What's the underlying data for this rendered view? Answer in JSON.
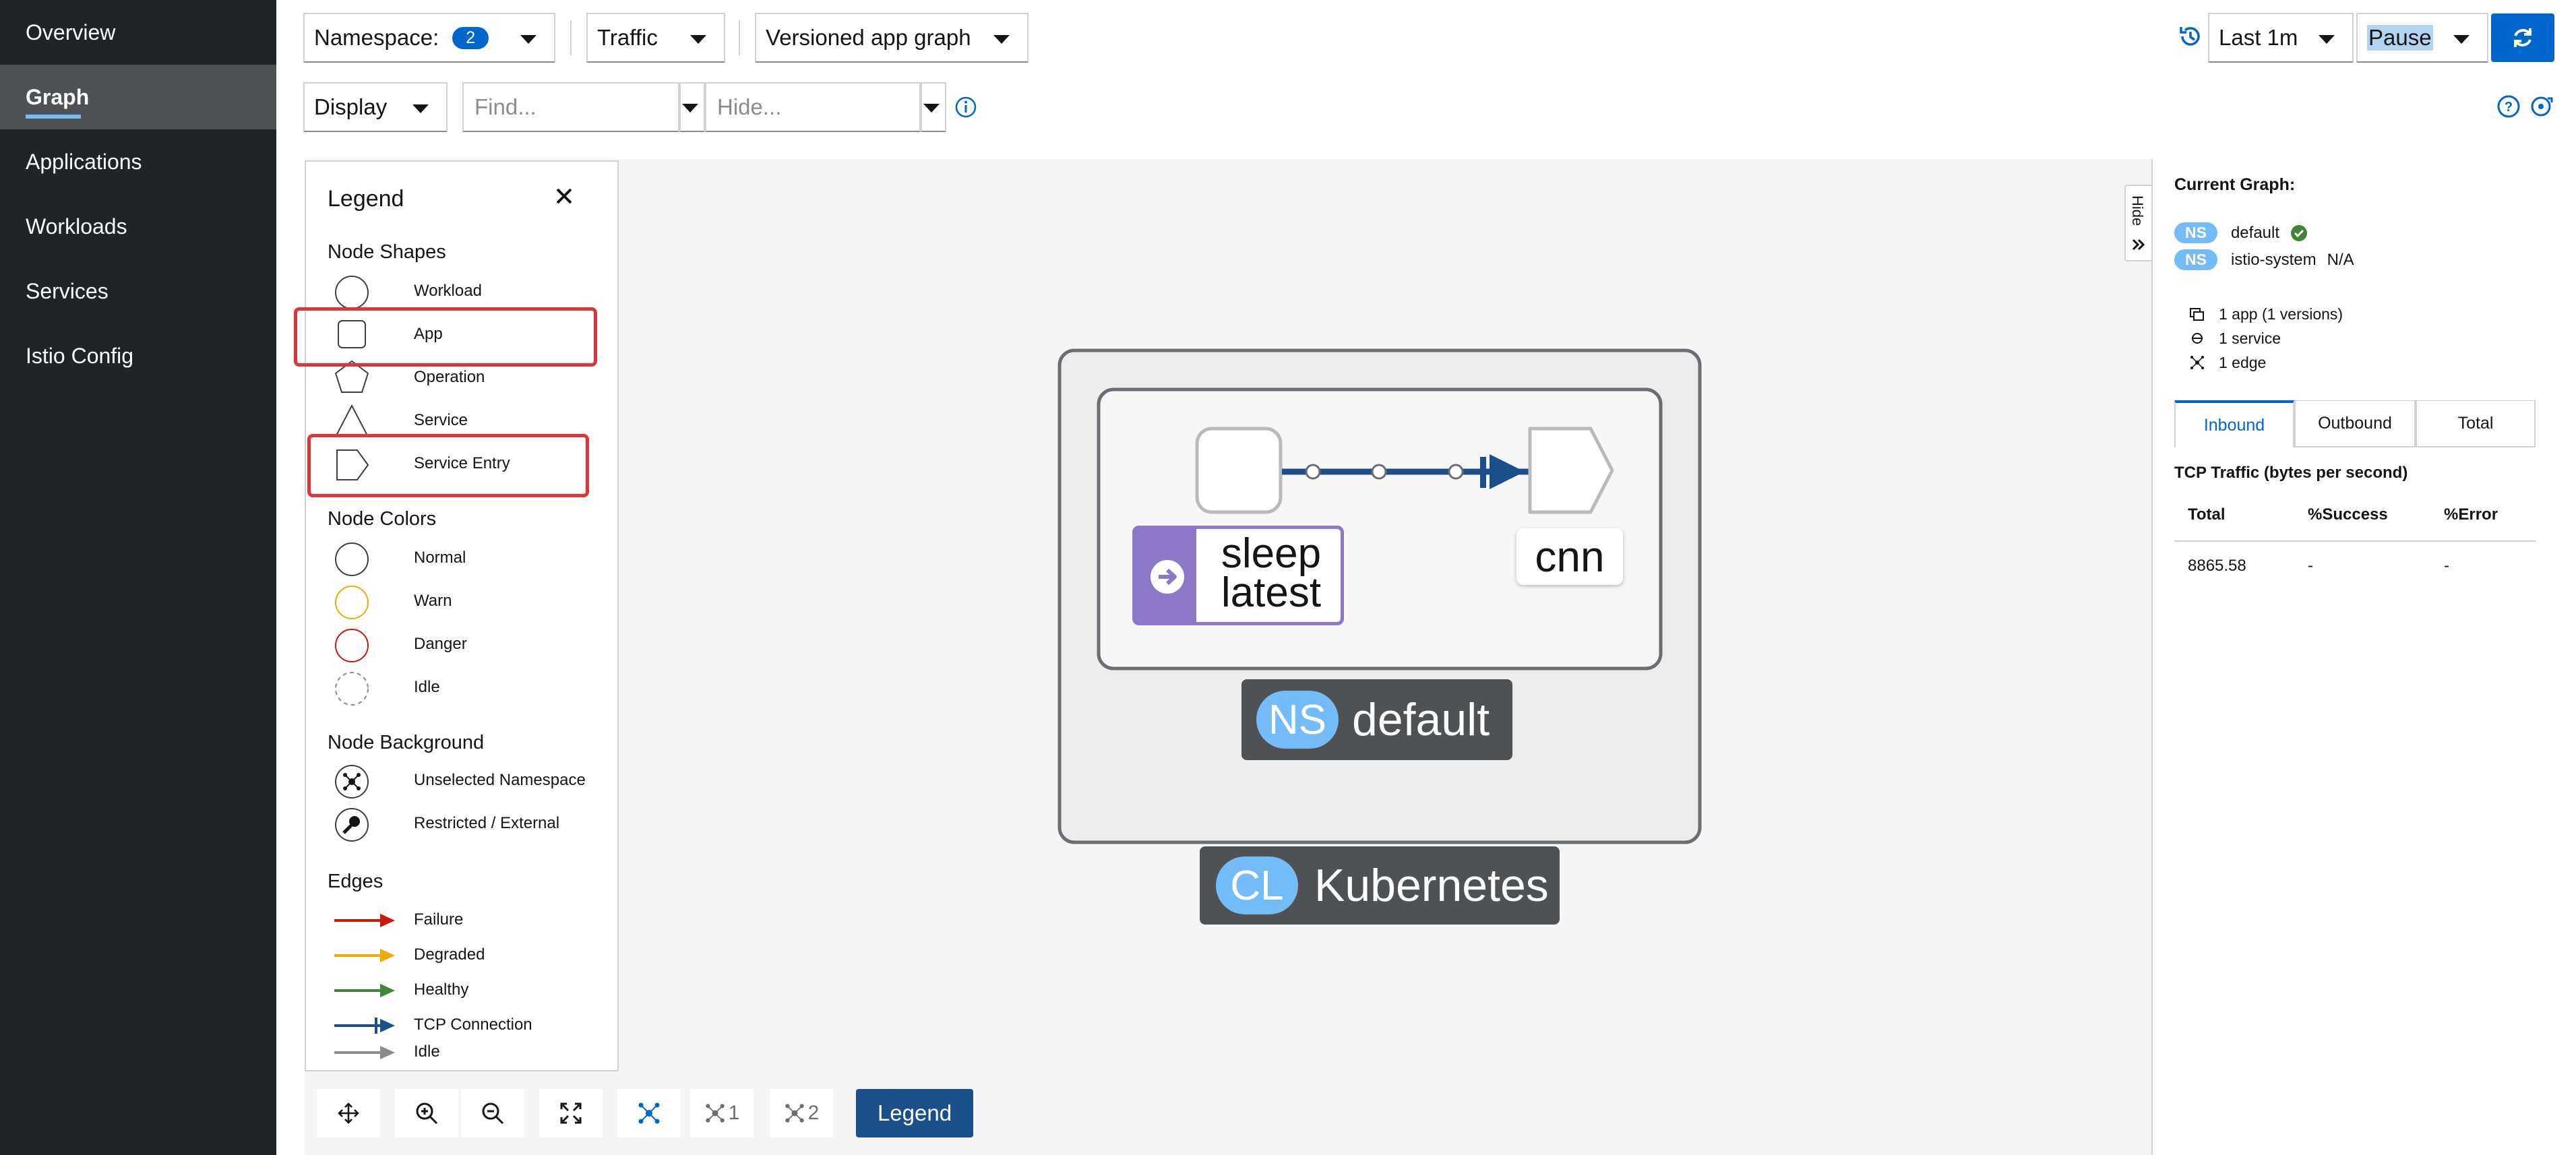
{
  "sidebar": {
    "items": [
      {
        "label": "Overview"
      },
      {
        "label": "Graph"
      },
      {
        "label": "Applications"
      },
      {
        "label": "Workloads"
      },
      {
        "label": "Services"
      },
      {
        "label": "Istio Config"
      }
    ]
  },
  "toolbar": {
    "namespace_label": "Namespace:",
    "namespace_count": "2",
    "traffic_label": "Traffic",
    "graph_type": "Versioned app graph",
    "display_label": "Display",
    "find_placeholder": "Find...",
    "hide_placeholder": "Hide...",
    "duration": "Last 1m",
    "refresh_interval": "Pause"
  },
  "legend": {
    "title": "Legend",
    "node_shapes_heading": "Node Shapes",
    "node_shapes": [
      "Workload",
      "App",
      "Operation",
      "Service",
      "Service Entry"
    ],
    "node_colors_heading": "Node Colors",
    "node_colors": [
      "Normal",
      "Warn",
      "Danger",
      "Idle"
    ],
    "node_background_heading": "Node Background",
    "node_backgrounds": [
      "Unselected Namespace",
      "Restricted / External"
    ],
    "edges_heading": "Edges",
    "edges": [
      "Failure",
      "Degraded",
      "Healthy",
      "TCP Connection",
      "Idle"
    ],
    "colors": {
      "failure": "#c9190b",
      "degraded": "#f0ab00",
      "healthy": "#3e8635",
      "tcp": "#1b4f8a",
      "idle": "#8a8d90",
      "highlight": "#e0333a"
    }
  },
  "graph": {
    "app_node_label_line1": "sleep",
    "app_node_label_line2": "latest",
    "service_entry_label": "cnn",
    "namespace_badge": "NS",
    "namespace_name": "default",
    "cluster_badge": "CL",
    "cluster_name": "Kubernetes"
  },
  "panel": {
    "hide_label": "Hide",
    "current_graph_label": "Current Graph:",
    "namespaces": [
      {
        "badge": "NS",
        "name": "default",
        "status": ""
      },
      {
        "badge": "NS",
        "name": "istio-system",
        "status": "N/A"
      }
    ],
    "stats": [
      "1 app (1 versions)",
      "1 service",
      "1 edge"
    ],
    "tabs": [
      "Inbound",
      "Outbound",
      "Total"
    ],
    "tcp_title": "TCP Traffic (bytes per second)",
    "table_headers": [
      "Total",
      "%Success",
      "%Error"
    ],
    "table_row": [
      "8865.58",
      "-",
      "-"
    ]
  },
  "bottom_toolbar": {
    "layout1_count": "1",
    "layout2_count": "2",
    "legend_label": "Legend"
  }
}
